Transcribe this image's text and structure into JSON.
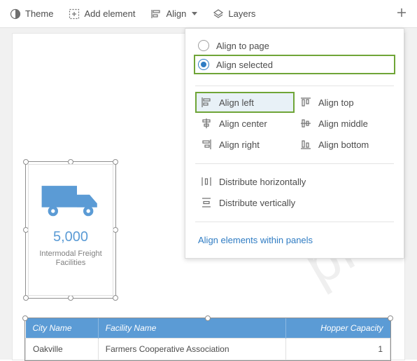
{
  "toolbar": {
    "theme_label": "Theme",
    "add_element_label": "Add element",
    "align_label": "Align",
    "layers_label": "Layers"
  },
  "align_menu": {
    "radios": {
      "align_to_page": "Align to page",
      "align_selected": "Align selected"
    },
    "options": {
      "align_left": "Align left",
      "align_center": "Align center",
      "align_right": "Align right",
      "align_top": "Align top",
      "align_middle": "Align middle",
      "align_bottom": "Align bottom"
    },
    "distribute": {
      "horizontal": "Distribute horizontally",
      "vertical": "Distribute vertically"
    },
    "link": "Align elements within panels"
  },
  "card": {
    "value": "5,000",
    "label1": "Intermodal Freight",
    "label2": "Facilities"
  },
  "table": {
    "headers": {
      "city": "City Name",
      "facility": "Facility Name",
      "hopper": "Hopper Capacity"
    },
    "row0": {
      "city": "Oakville",
      "facility": "Farmers Cooperative Association",
      "hopper": "1"
    }
  }
}
